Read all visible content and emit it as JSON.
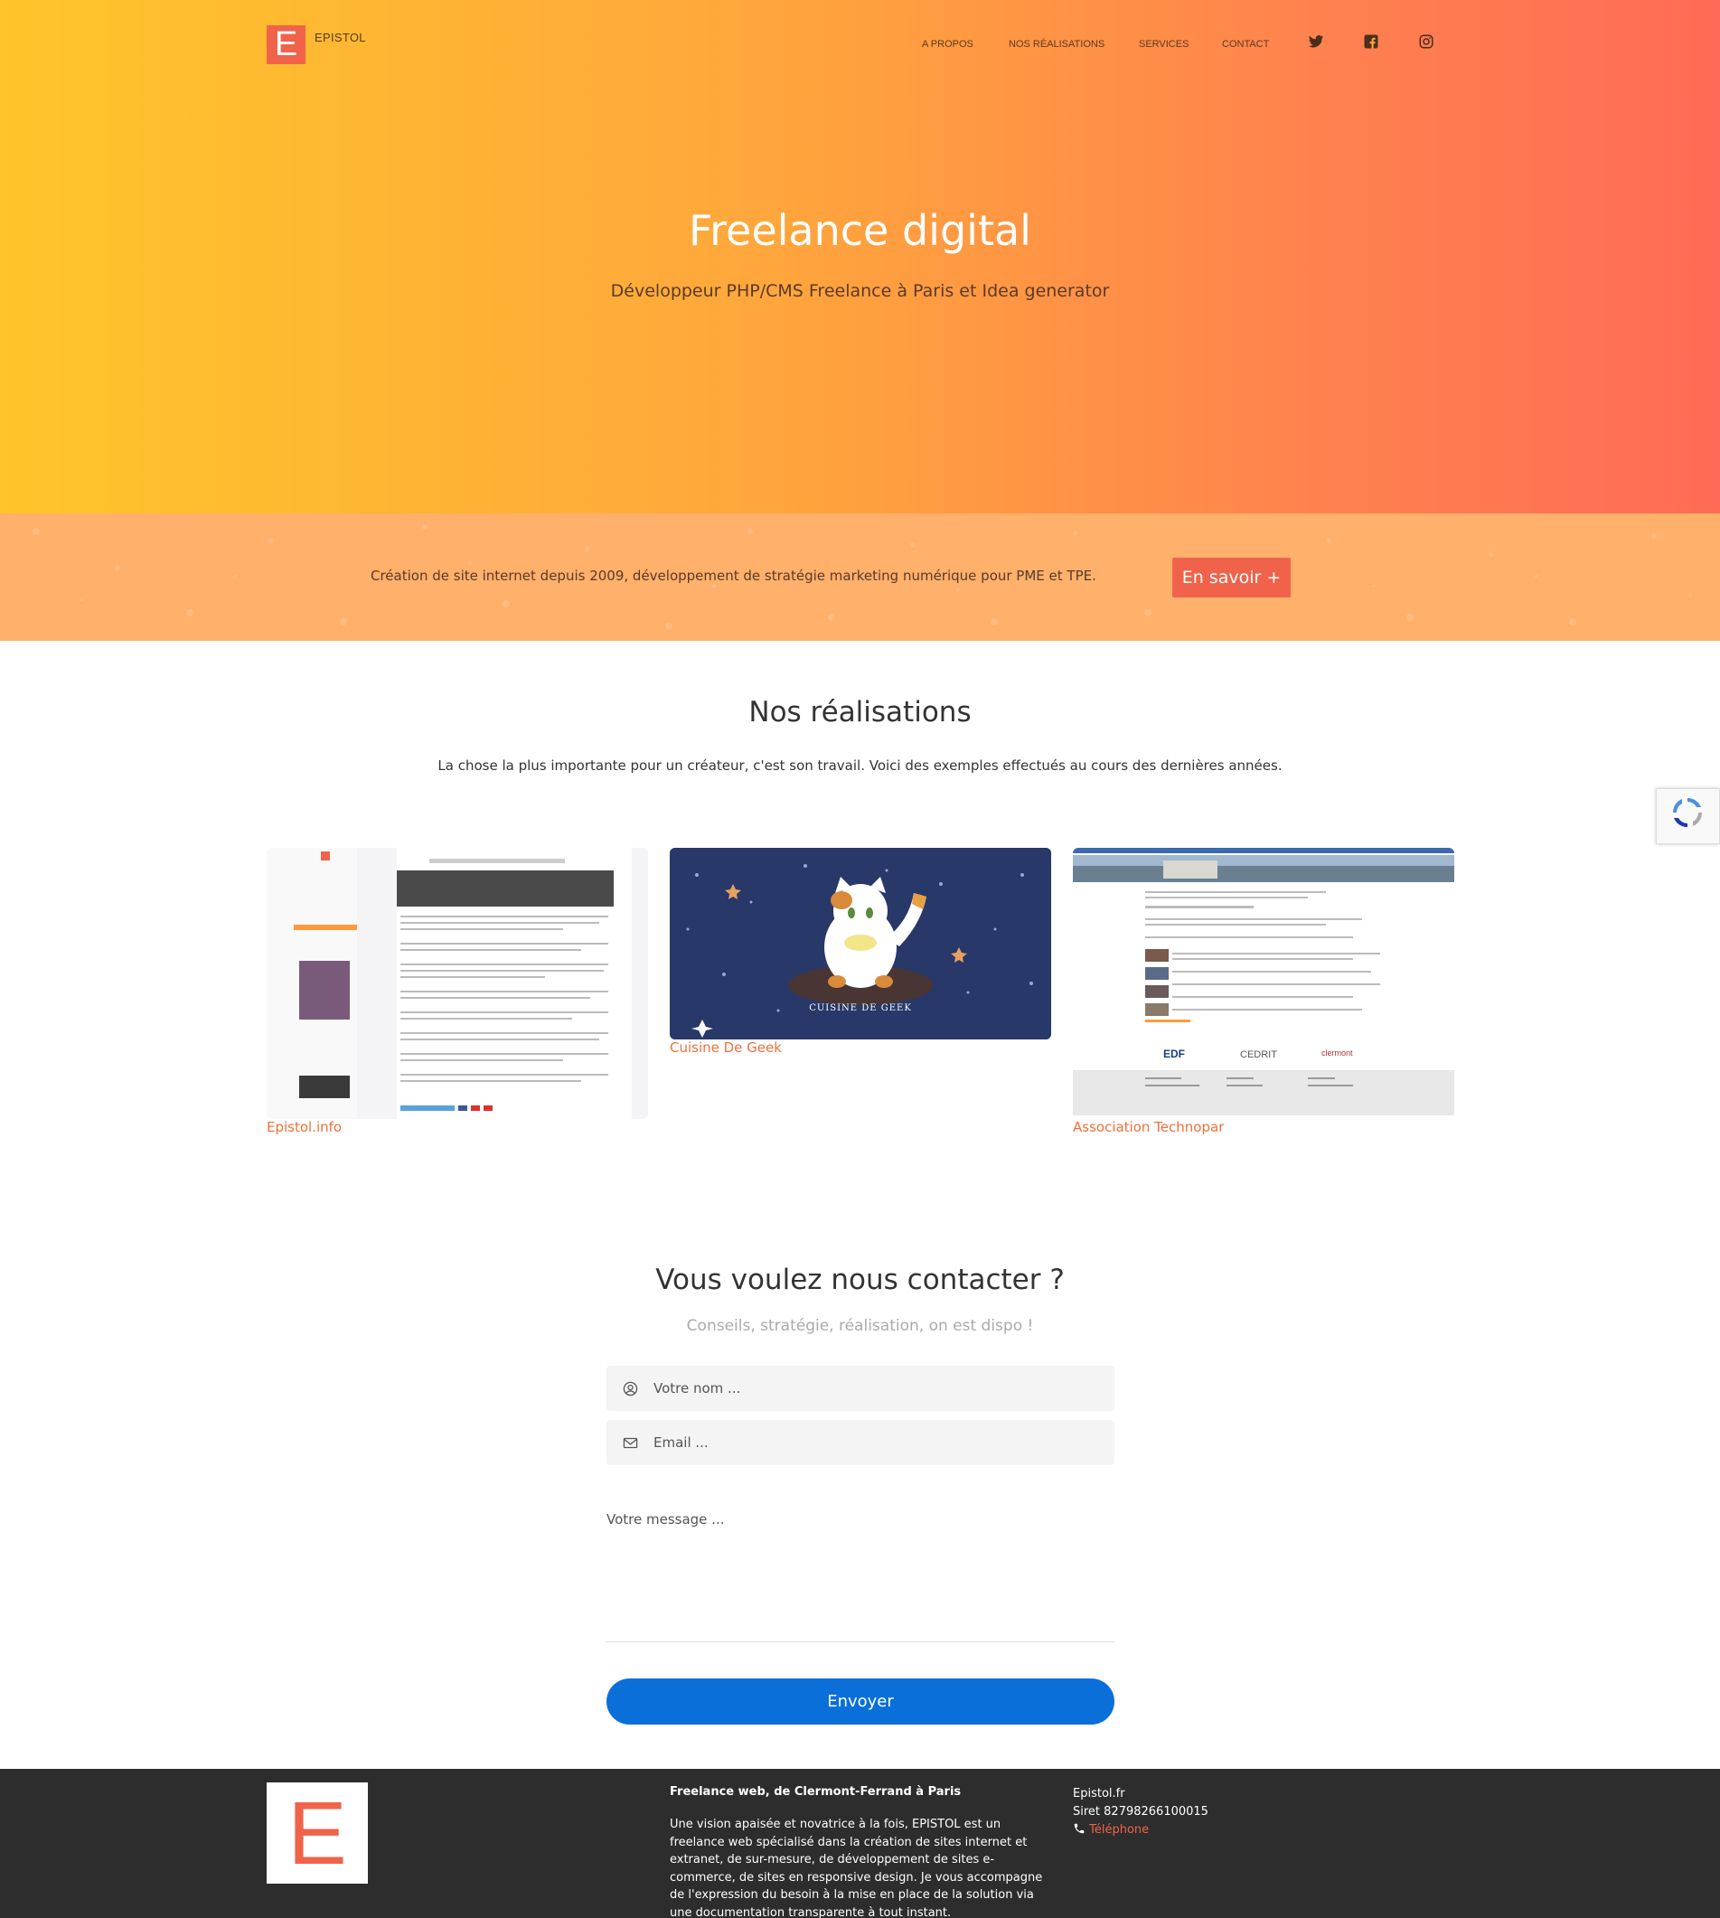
{
  "header": {
    "logo_letter": "E",
    "brand": "EPISTOL",
    "nav": [
      "A PROPOS",
      "NOS RÉALISATIONS",
      "SERVICES",
      "CONTACT"
    ],
    "social_icons": [
      "twitter-icon",
      "facebook-icon",
      "instagram-icon"
    ]
  },
  "hero": {
    "title": "Freelance digital",
    "subtitle": "Développeur PHP/CMS Freelance à Paris et Idea generator"
  },
  "band": {
    "text": "Création de site internet depuis 2009, développement de stratégie marketing numérique pour PME et TPE.",
    "button": "En savoir +"
  },
  "realisations": {
    "title": "Nos réalisations",
    "subtitle": "La chose la plus importante pour un créateur, c'est son travail. Voici des exemples effectués au cours des dernières années.",
    "projects": [
      {
        "name": "Epistol.info"
      },
      {
        "name": "Cuisine De Geek",
        "image_text": "CUISINE DE GEEK"
      },
      {
        "name": "Association Technopar"
      }
    ]
  },
  "contact": {
    "title": "Vous voulez nous contacter ?",
    "subtitle": "Conseils, stratégie, réalisation, on est dispo !",
    "name_placeholder": "Votre nom ...",
    "email_placeholder": "Email ...",
    "message_placeholder": "Votre message ...",
    "send": "Envoyer"
  },
  "footer": {
    "logo_letter": "E",
    "title": "Freelance web, de Clermont-Ferrand à Paris",
    "description": "Une vision apaisée et novatrice à la fois, EPISTOL est un freelance web spécialisé dans la création de sites internet et extranet, de sur-mesure, de développement de sites e-commerce, de sites en responsive design. Je vous accompagne de l'expression du besoin à la mise en place de la solution via une documentation transparente à tout instant.",
    "site": "Epistol.fr",
    "siret": "Siret 82798266100015",
    "phone_label": "Téléphone"
  },
  "colors": {
    "accent": "#f0634a",
    "hero_start": "#ffc52a",
    "hero_end": "#ff6b56",
    "band": "#ffb06a",
    "button_blue": "#0a6fd8",
    "footer": "#2d2d2d"
  }
}
